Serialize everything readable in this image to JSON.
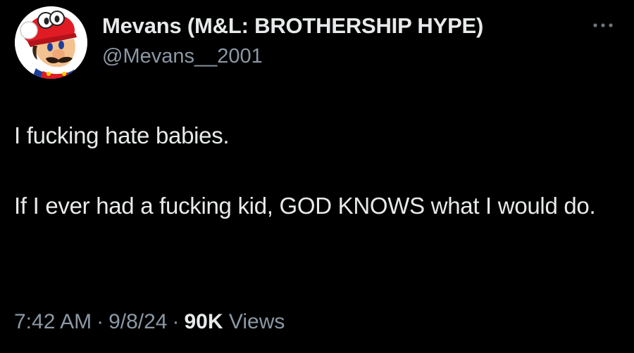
{
  "author": {
    "display_name": "Mevans (M&L: BROTHERSHIP HYPE)",
    "handle": "@Mevans__2001",
    "avatar_icon": "mario-avatar-icon"
  },
  "more_icon": "more-horizontal-icon",
  "tweet": {
    "paragraphs": [
      "I fucking hate babies.",
      "If I ever had a fucking kid, GOD KNOWS what I would do."
    ]
  },
  "meta": {
    "time": "7:42 AM",
    "date": "9/8/24",
    "separator": "·",
    "views_count": "90K",
    "views_label": "Views"
  },
  "colors": {
    "background": "#000000",
    "primary_text": "#e7e9ea",
    "secondary_text": "#8b98a5"
  }
}
